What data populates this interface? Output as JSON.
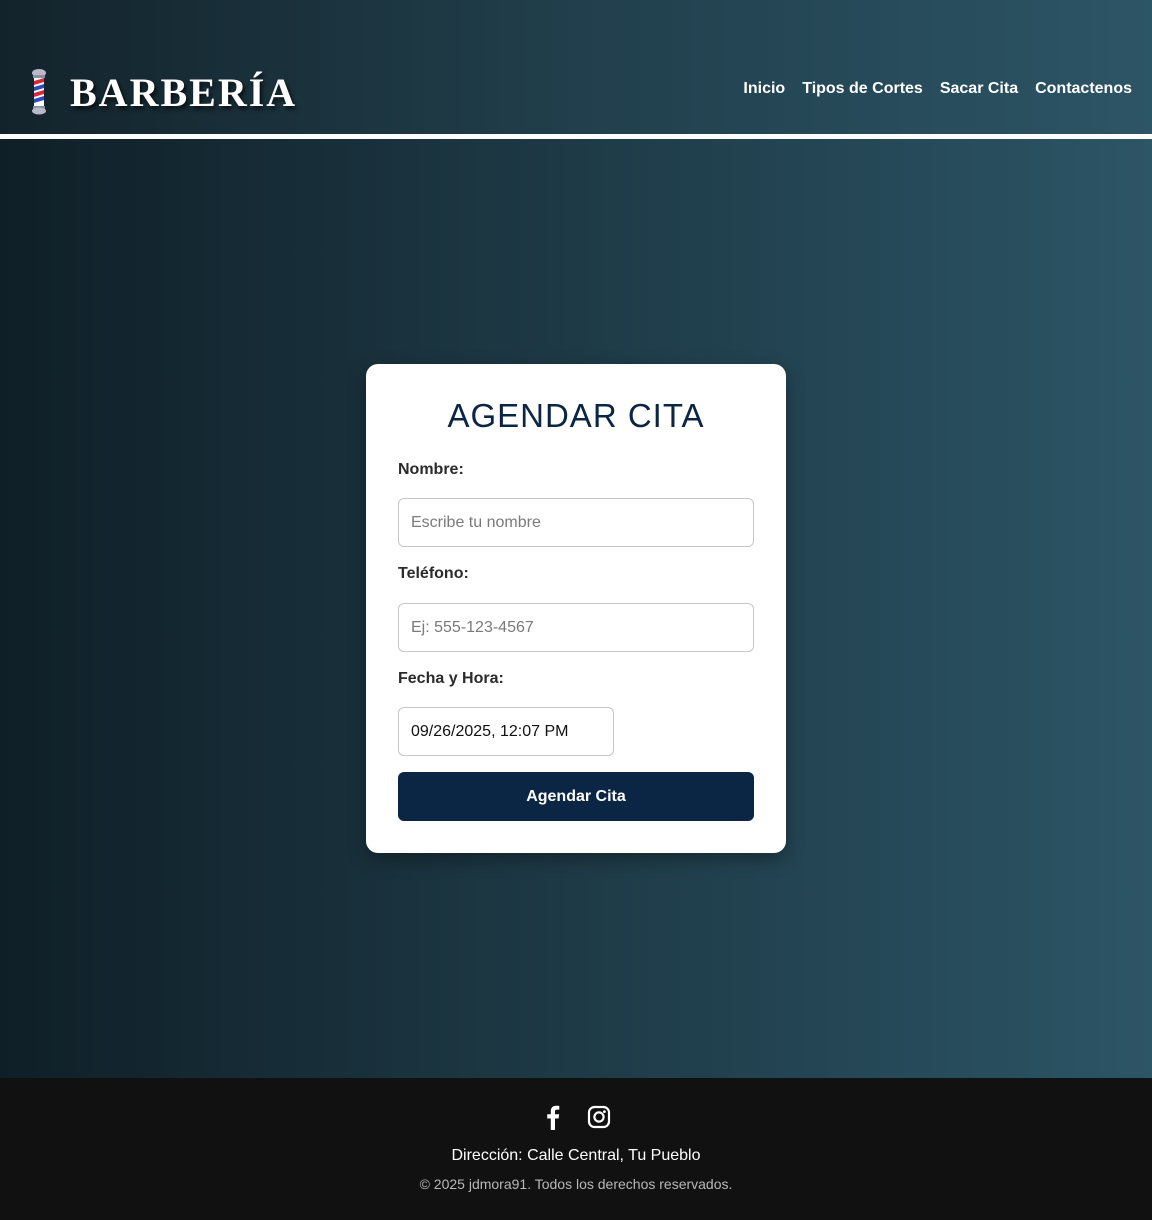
{
  "header": {
    "logo_text": "BARBERÍA",
    "logo_icon": "barber-pole-icon",
    "nav": [
      {
        "label": "Inicio"
      },
      {
        "label": "Tipos de Cortes"
      },
      {
        "label": "Sacar Cita"
      },
      {
        "label": "Contactenos"
      }
    ]
  },
  "form": {
    "title": "AGENDAR CITA",
    "name_label": "Nombre:",
    "name_placeholder": "Escribe tu nombre",
    "phone_label": "Teléfono:",
    "phone_placeholder": "Ej: 555-123-4567",
    "datetime_label": "Fecha y Hora:",
    "datetime_value": "09/26/2025, 12:07 PM",
    "submit_label": "Agendar Cita"
  },
  "footer": {
    "social": [
      "facebook-icon",
      "instagram-icon"
    ],
    "address": "Dirección: Calle Central, Tu Pueblo",
    "copyright": "© 2025 jdmora91. Todos los derechos reservados."
  },
  "colors": {
    "primary": "#0b2545",
    "footer_bg": "#111111",
    "gradient_start": "#0f1f27",
    "gradient_end": "#2c5566"
  }
}
